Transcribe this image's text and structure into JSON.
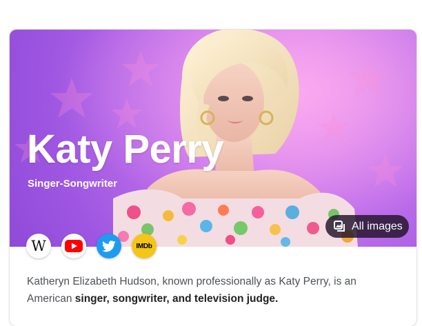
{
  "entity": {
    "name": "Katy Perry",
    "category": "Singer-Songwriter"
  },
  "hero": {
    "image_alt": "Katy Perry portrait",
    "all_images_label": "All images"
  },
  "social_links": [
    {
      "name": "wikipedia",
      "glyph": "W",
      "icon": "wikipedia-icon"
    },
    {
      "name": "youtube",
      "icon": "youtube-icon"
    },
    {
      "name": "twitter",
      "icon": "twitter-icon"
    },
    {
      "name": "imdb",
      "glyph": "IMDb",
      "icon": "imdb-icon"
    }
  ],
  "description": {
    "text": "Katheryn Elizabeth Hudson, known professionally as Katy Perry, is an American ",
    "bold": "singer, songwriter, and television judge."
  },
  "colors": {
    "hero_bg": "#b766e8",
    "button_bg": "#2a1b33",
    "twitter": "#1d9bf0",
    "youtube": "#ff0000",
    "imdb": "#f5c518",
    "text": "#4d5156"
  }
}
